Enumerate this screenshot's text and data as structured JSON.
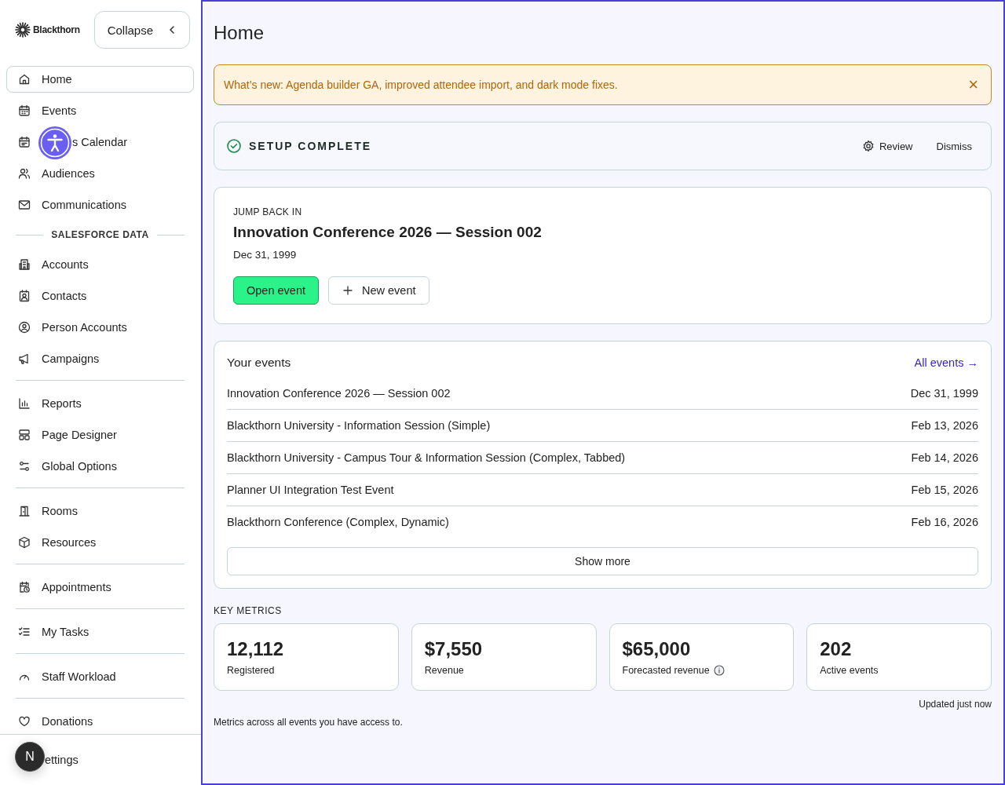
{
  "sidebar": {
    "brand": "Blackthorn",
    "collapse_button": "Collapse",
    "groups": [
      {
        "items": [
          {
            "label": "Home",
            "selected": true
          },
          {
            "label": "Events",
            "selected": false
          },
          {
            "label": "s Calendar",
            "selected": false
          },
          {
            "label": "Audiences",
            "selected": false
          },
          {
            "label": "Communications",
            "selected": false
          }
        ]
      },
      {
        "heading": "SALESFORCE DATA",
        "items": [
          {
            "label": "Accounts",
            "selected": false
          },
          {
            "label": "Contacts",
            "selected": false
          },
          {
            "label": "Person Accounts",
            "selected": false
          },
          {
            "label": "Campaigns",
            "selected": false
          }
        ]
      },
      {
        "items": [
          {
            "label": "Reports",
            "selected": false
          },
          {
            "label": "Page Designer",
            "selected": false
          },
          {
            "label": "Global Options",
            "selected": false
          }
        ]
      },
      {
        "items": [
          {
            "label": "Rooms",
            "selected": false
          },
          {
            "label": "Resources",
            "selected": false
          }
        ]
      },
      {
        "items": [
          {
            "label": "Appointments",
            "selected": false
          }
        ]
      },
      {
        "items": [
          {
            "label": "My Tasks",
            "selected": false
          }
        ]
      },
      {
        "items": [
          {
            "label": "Staff Workload",
            "selected": false
          }
        ]
      },
      {
        "items": [
          {
            "label": "Donations",
            "selected": false
          }
        ]
      }
    ],
    "footer_item": {
      "label": "ettings"
    },
    "avatar": "N"
  },
  "main": {
    "title": "Home",
    "banner": {
      "text": "What’s new: Agenda builder GA, improved attendee import, and dark mode fixes.",
      "close": "×"
    },
    "setup": {
      "title": "SETUP COMPLETE",
      "actions": [
        "Review",
        "Dismiss"
      ]
    },
    "jump_back": {
      "label": "JUMP BACK IN",
      "event": "Innovation Conference 2026 — Session 002",
      "date": "Dec 31, 1999",
      "primary_button": "Open event",
      "secondary_button": "New event"
    },
    "your_events": {
      "title": "Your events",
      "link": "All events →",
      "rows": [
        {
          "name": "Innovation Conference 2026 — Session 002",
          "date": "Dec 31, 1999"
        },
        {
          "name": "Blackthorn University - Information Session (Simple)",
          "date": "Feb 13, 2026"
        },
        {
          "name": "Blackthorn University - Campus Tour & Information Session (Complex, Tabbed)",
          "date": "Feb 14, 2026"
        },
        {
          "name": "Planner UI Integration Test Event",
          "date": "Feb 15, 2026"
        },
        {
          "name": "Blackthorn Conference (Complex, Dynamic)",
          "date": "Feb 16, 2026"
        }
      ],
      "show_more": "Show more"
    },
    "key_metrics": {
      "title": "KEY METRICS",
      "cards": [
        {
          "value": "12,112",
          "label": "Registered",
          "info": false
        },
        {
          "value": "$7,550",
          "label": "Revenue",
          "info": false
        },
        {
          "value": "$65,000",
          "label": "Forecasted revenue",
          "info": true
        },
        {
          "value": "202",
          "label": "Active events",
          "info": false
        }
      ],
      "updated": "Updated just now",
      "note": "Metrics across all events you have access to."
    }
  }
}
